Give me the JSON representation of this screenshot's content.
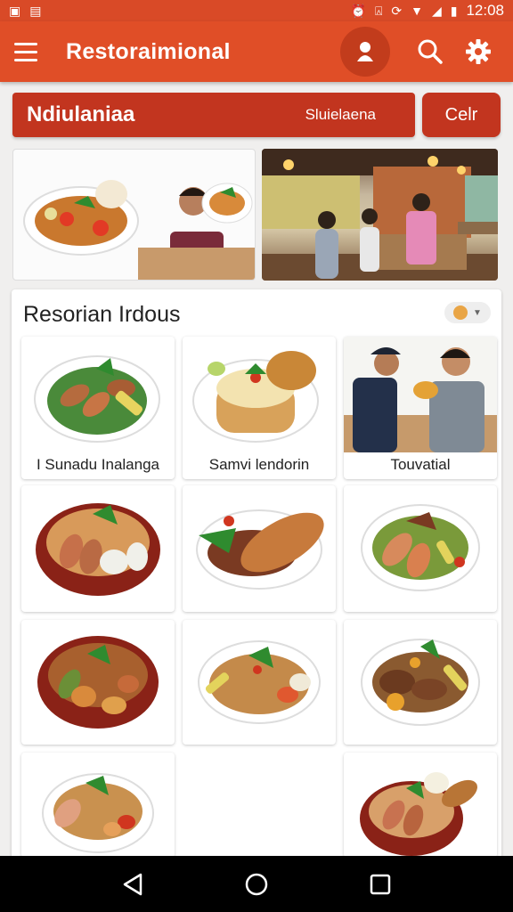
{
  "status_bar": {
    "time": "12:08"
  },
  "app_bar": {
    "title": "Restoraimional",
    "icons": [
      "menu-icon",
      "profile-icon",
      "search-icon",
      "settings-icon"
    ]
  },
  "banner": {
    "title": "Ndiulaniaa",
    "subtitle": "Sluielaena",
    "button_label": "Celr"
  },
  "section": {
    "title": "Resorian Irdous",
    "filter_icon": "filter-icon"
  },
  "cards": [
    {
      "label": "I Sunadu Inalanga",
      "image": "dish-plate"
    },
    {
      "label": "Samvi lendorin",
      "image": "noodle-plate-with-bread"
    },
    {
      "label": "Touvatial",
      "image": "people-eating"
    },
    {
      "label": "",
      "image": "dish-bowl"
    },
    {
      "label": "",
      "image": "fried-fish-plate"
    },
    {
      "label": "",
      "image": "salad-bowl"
    },
    {
      "label": "",
      "image": "stew-bowl"
    },
    {
      "label": "",
      "image": "rice-plate"
    },
    {
      "label": "",
      "image": "meat-bowl"
    },
    {
      "label": "",
      "image": "rice-bowl"
    },
    {
      "label": "",
      "image": "mixed-plate-bowl"
    }
  ],
  "colors": {
    "primary": "#e04e27",
    "primary_dark": "#c2351f",
    "background": "#f0efee"
  },
  "nav_bar": {
    "icons": [
      "back-icon",
      "home-icon",
      "recents-icon"
    ]
  }
}
